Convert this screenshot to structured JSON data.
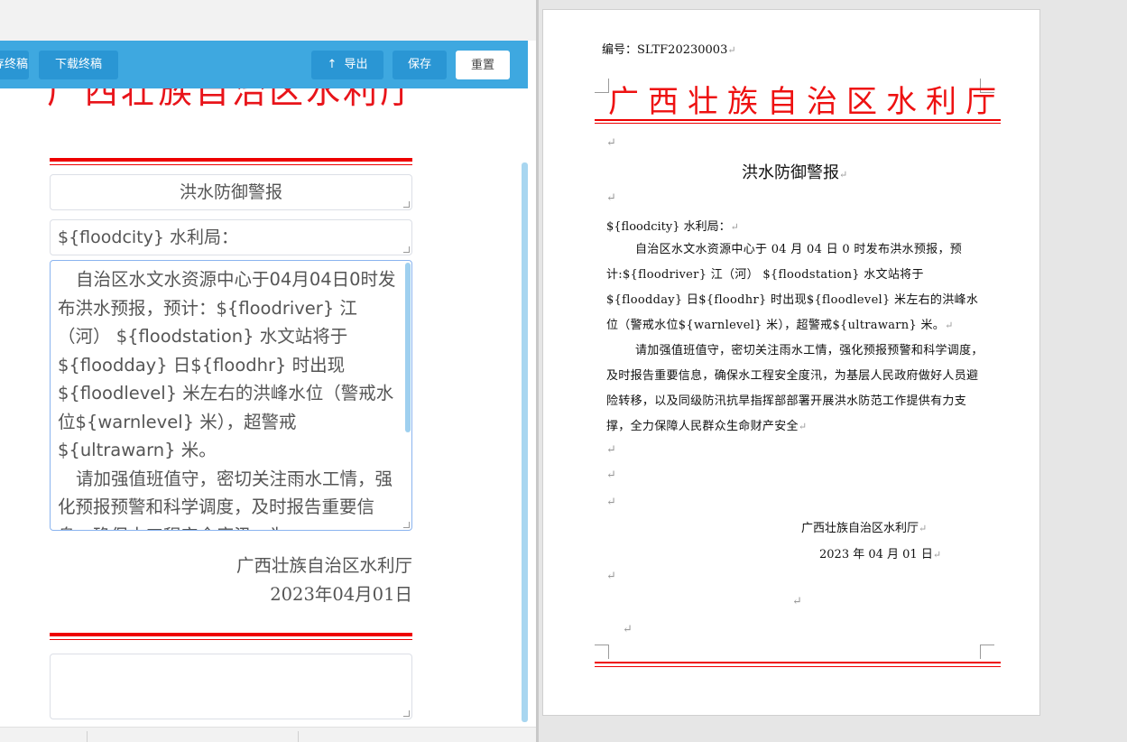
{
  "editor": {
    "toolbar": {
      "save_draft_label": "保存终稿",
      "download_final_label": "下载终稿",
      "export_label": "导出",
      "save_label": "保存",
      "reset_label": "重置"
    },
    "title_banner": "广西壮族自治区水利厅",
    "title_field_value": "洪水防御警报",
    "greeting_field_value": "${floodcity} 水利局：",
    "body_paragraphs": [
      "自治区水文水资源中心于04月04日0时发布洪水预报，预计：${floodriver} 江（河） ${floodstation} 水文站将于${floodday} 日${floodhr} 时出现${floodlevel} 米左右的洪峰水位（警戒水位${warnlevel} 米），超警戒${ultrawarn} 米。",
      "请加强值班值守，密切关注雨水工情，强化预报预警和科学调度，及时报告重要信息，确保水工程安全度汛，为"
    ],
    "signature_org": "广西壮族自治区水利厅",
    "signature_date": "2023年04月01日",
    "footer_field_value": ""
  },
  "preview": {
    "doc_number": "编号：SLTF20230003",
    "title": "广西壮族自治区水利厅",
    "subtitle": "洪水防御警报",
    "greeting": "${floodcity} 水利局：",
    "body_paragraphs": [
      "自治区水文水资源中心于 04 月 04 日 0 时发布洪水预报，预计:${floodriver} 江（河） ${floodstation} 水文站将于${floodday} 日${floodhr} 时出现${floodlevel} 米左右的洪峰水位（警戒水位${warnlevel} 米），超警戒${ultrawarn} 米。",
      "请加强值班值守，密切关注雨水工情，强化预报预警和科学调度，及时报告重要信息，确保水工程安全度汛，为基层人民政府做好人员避险转移，以及同级防汛抗旱指挥部部署开展洪水防范工作提供有力支撑，全力保障人民群众生命财产安全"
    ],
    "signature_org": "广西壮族自治区水利厅",
    "signature_date": "2023 年 04 月 01 日",
    "paragraph_mark": "↵"
  },
  "colors": {
    "toolbar": "#3ea8e0",
    "button": "#2a96d4",
    "red_title": "#e8141a",
    "rule_red": "#ee0000"
  },
  "icons": {
    "export": "upload-arrow-icon"
  }
}
